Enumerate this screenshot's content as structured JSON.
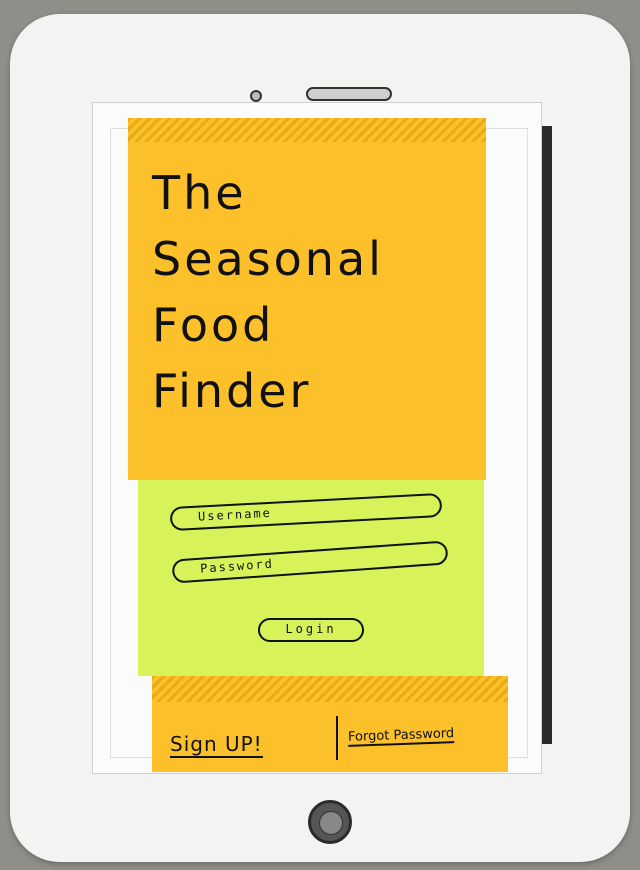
{
  "app": {
    "title": "The\nSeasonal\nFood\nFinder"
  },
  "login": {
    "username_placeholder": "Username",
    "password_placeholder": "Password",
    "login_label": "Login"
  },
  "links": {
    "signup_label": "Sign UP!",
    "forgot_label": "Forgot Password"
  },
  "colors": {
    "sticky_orange": "#fcc12a",
    "sticky_green": "#d8f25a",
    "tablet": "#f3f3f1"
  }
}
